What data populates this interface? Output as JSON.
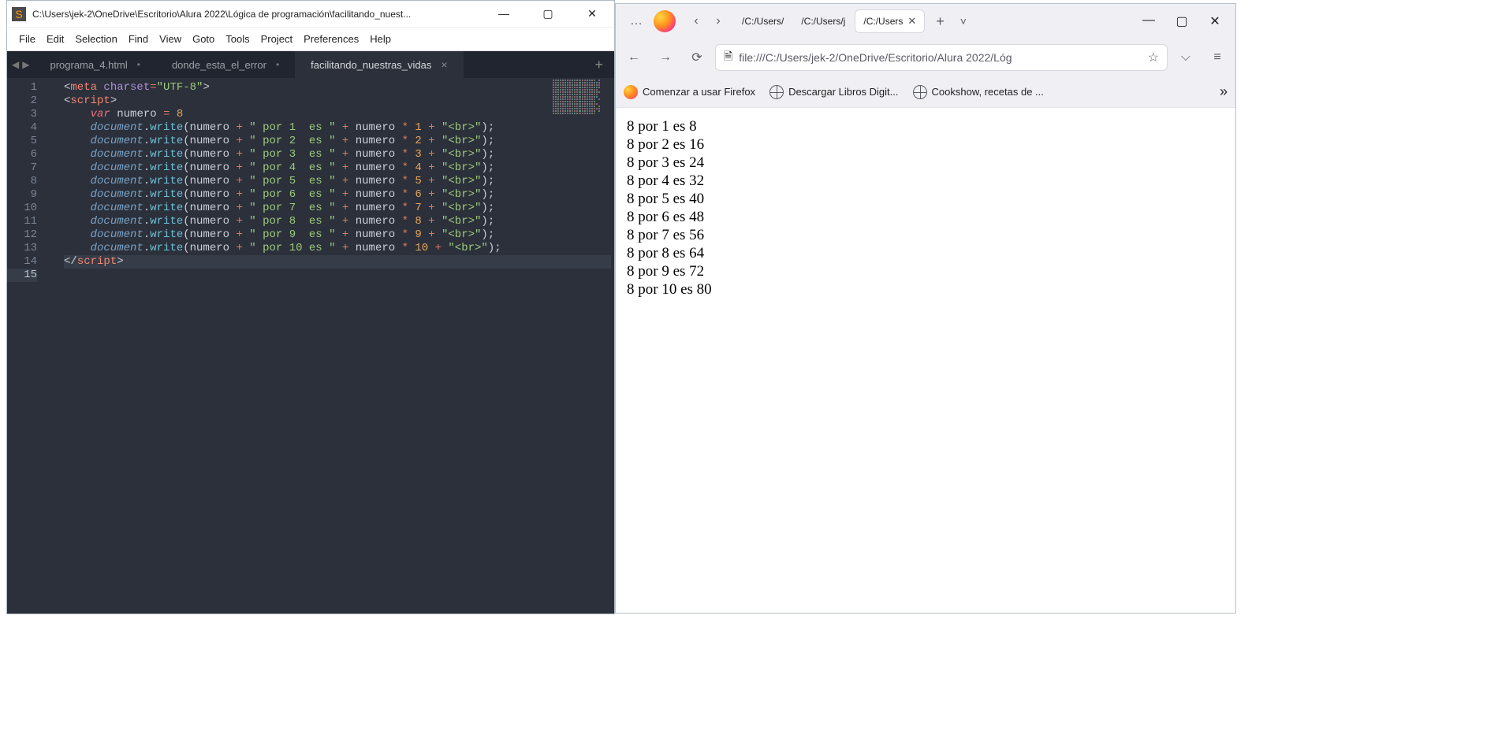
{
  "sublime": {
    "title": "C:\\Users\\jek-2\\OneDrive\\Escritorio\\Alura 2022\\Lógica de programación\\facilitando_nuest...",
    "menu": [
      "File",
      "Edit",
      "Selection",
      "Find",
      "View",
      "Goto",
      "Tools",
      "Project",
      "Preferences",
      "Help"
    ],
    "nav": {
      "back": "◀",
      "fwd": "▶"
    },
    "tabs": [
      {
        "label": "programa_4.html",
        "close": "•"
      },
      {
        "label": "donde_esta_el_error",
        "close": "•"
      },
      {
        "label": "facilitando_nuestras_vidas",
        "close": "×",
        "active": true
      }
    ],
    "plus": "+",
    "code": {
      "lines_count": 15,
      "numero": 8
    },
    "win": {
      "min": "—",
      "max": "▢",
      "close": "✕"
    }
  },
  "firefox": {
    "navlr": {
      "l": "‹",
      "r": "›"
    },
    "ellipsis": "…",
    "tabs": [
      {
        "label": "/C:/Users/",
        "active": false
      },
      {
        "label": "/C:/Users/j",
        "active": false
      },
      {
        "label": "/C:/Users",
        "active": true,
        "close": "✕"
      }
    ],
    "newtab": "+",
    "dd": "˅",
    "win": {
      "min": "—",
      "max": "▢",
      "close": "✕"
    },
    "nav": {
      "back": "←",
      "fwd": "→",
      "reload": "⟳"
    },
    "url": "file:///C:/Users/jek-2/OneDrive/Escritorio/Alura 2022/Lóg",
    "star": "☆",
    "pocket": "⌵",
    "menu": "≡",
    "bookmarks": [
      {
        "label": "Comenzar a usar Firefox",
        "icon": "orange"
      },
      {
        "label": "Descargar Libros Digit...",
        "icon": "globe"
      },
      {
        "label": "Cookshow, recetas de ...",
        "icon": "globe"
      }
    ],
    "bm_overflow": "»",
    "output": [
      "8 por 1 es 8",
      "8 por 2 es 16",
      "8 por 3 es 24",
      "8 por 4 es 32",
      "8 por 5 es 40",
      "8 por 6 es 48",
      "8 por 7 es 56",
      "8 por 8 es 64",
      "8 por 9 es 72",
      "8 por 10 es 80"
    ]
  }
}
